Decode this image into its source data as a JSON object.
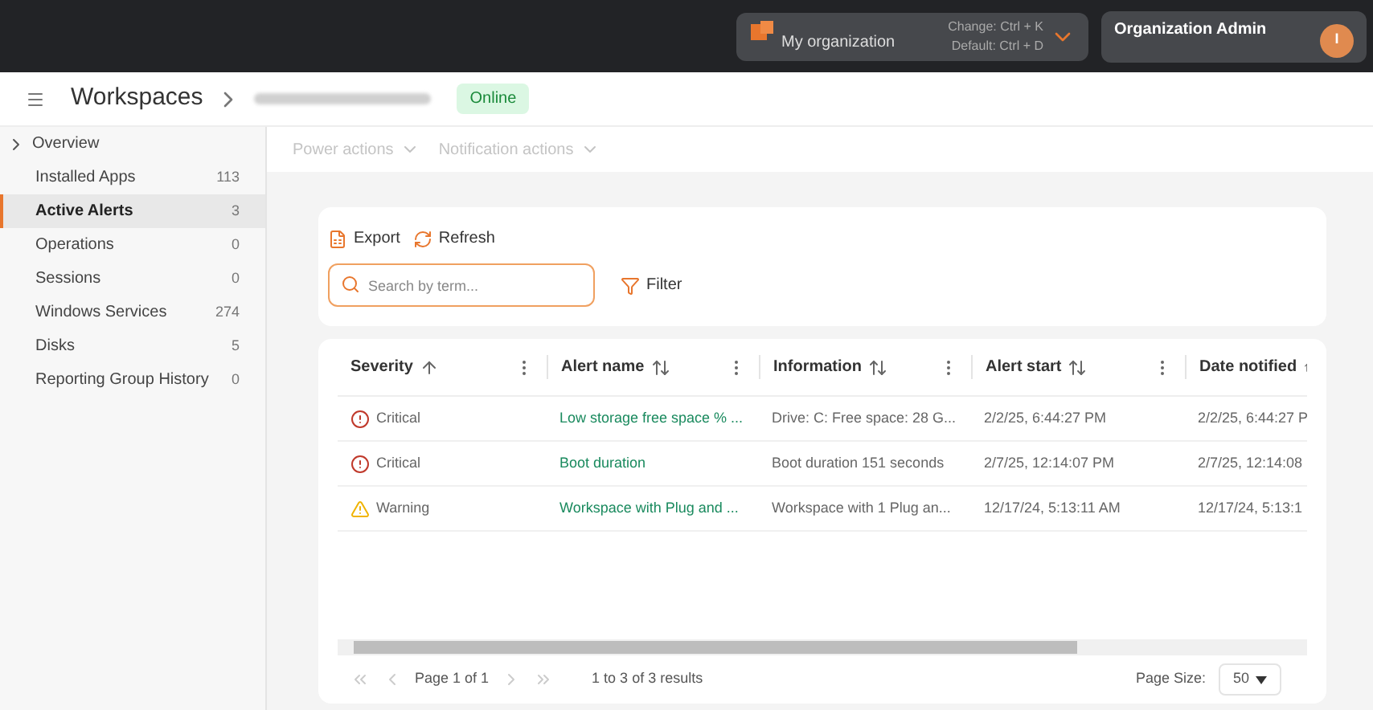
{
  "topbar": {
    "org": {
      "name": "My organization",
      "hint_change": "Change: Ctrl + K",
      "hint_default": "Default: Ctrl + D"
    },
    "user": {
      "role": "Organization Admin",
      "initial": "I"
    }
  },
  "header": {
    "title": "Workspaces",
    "status": "Online"
  },
  "sidebar": {
    "overview": {
      "label": "Overview",
      "expanded": false
    },
    "items": [
      {
        "label": "Installed Apps",
        "count": "113",
        "selected": false
      },
      {
        "label": "Active Alerts",
        "count": "3",
        "selected": true
      },
      {
        "label": "Operations",
        "count": "0",
        "selected": false
      },
      {
        "label": "Sessions",
        "count": "0",
        "selected": false
      },
      {
        "label": "Windows Services",
        "count": "274",
        "selected": false
      },
      {
        "label": "Disks",
        "count": "5",
        "selected": false
      },
      {
        "label": "Reporting Group History",
        "count": "0",
        "selected": false
      }
    ]
  },
  "actions": [
    {
      "label": "Power actions",
      "disabled": true
    },
    {
      "label": "Notification actions",
      "disabled": true
    }
  ],
  "toolbar": {
    "export": "Export",
    "refresh": "Refresh",
    "search_placeholder": "Search by term...",
    "filter": "Filter"
  },
  "table": {
    "columns": [
      {
        "label": "Severity",
        "sorted": true
      },
      {
        "label": "Alert name",
        "sorted": false
      },
      {
        "label": "Information",
        "sorted": false
      },
      {
        "label": "Alert start",
        "sorted": false
      },
      {
        "label": "Date notified",
        "sorted": false
      }
    ],
    "rows": [
      {
        "kind": "critical",
        "severity": "Critical",
        "name": "Low storage free space % ...",
        "info": "Drive: C: Free space: 28 G...",
        "start": "2/2/25, 6:44:27 PM",
        "notified": "2/2/25, 6:44:27 P"
      },
      {
        "kind": "critical",
        "severity": "Critical",
        "name": "Boot duration",
        "info": "Boot duration 151 seconds",
        "start": "2/7/25, 12:14:07 PM",
        "notified": "2/7/25, 12:14:08"
      },
      {
        "kind": "warning",
        "severity": "Warning",
        "name": "Workspace with Plug and ...",
        "info": "Workspace with 1 Plug an...",
        "start": "12/17/24, 5:13:11 AM",
        "notified": "12/17/24, 5:13:1"
      }
    ]
  },
  "pager": {
    "page": "Page 1 of 1",
    "results": "1 to 3 of 3 results",
    "size_label": "Page Size:",
    "size": "50"
  }
}
